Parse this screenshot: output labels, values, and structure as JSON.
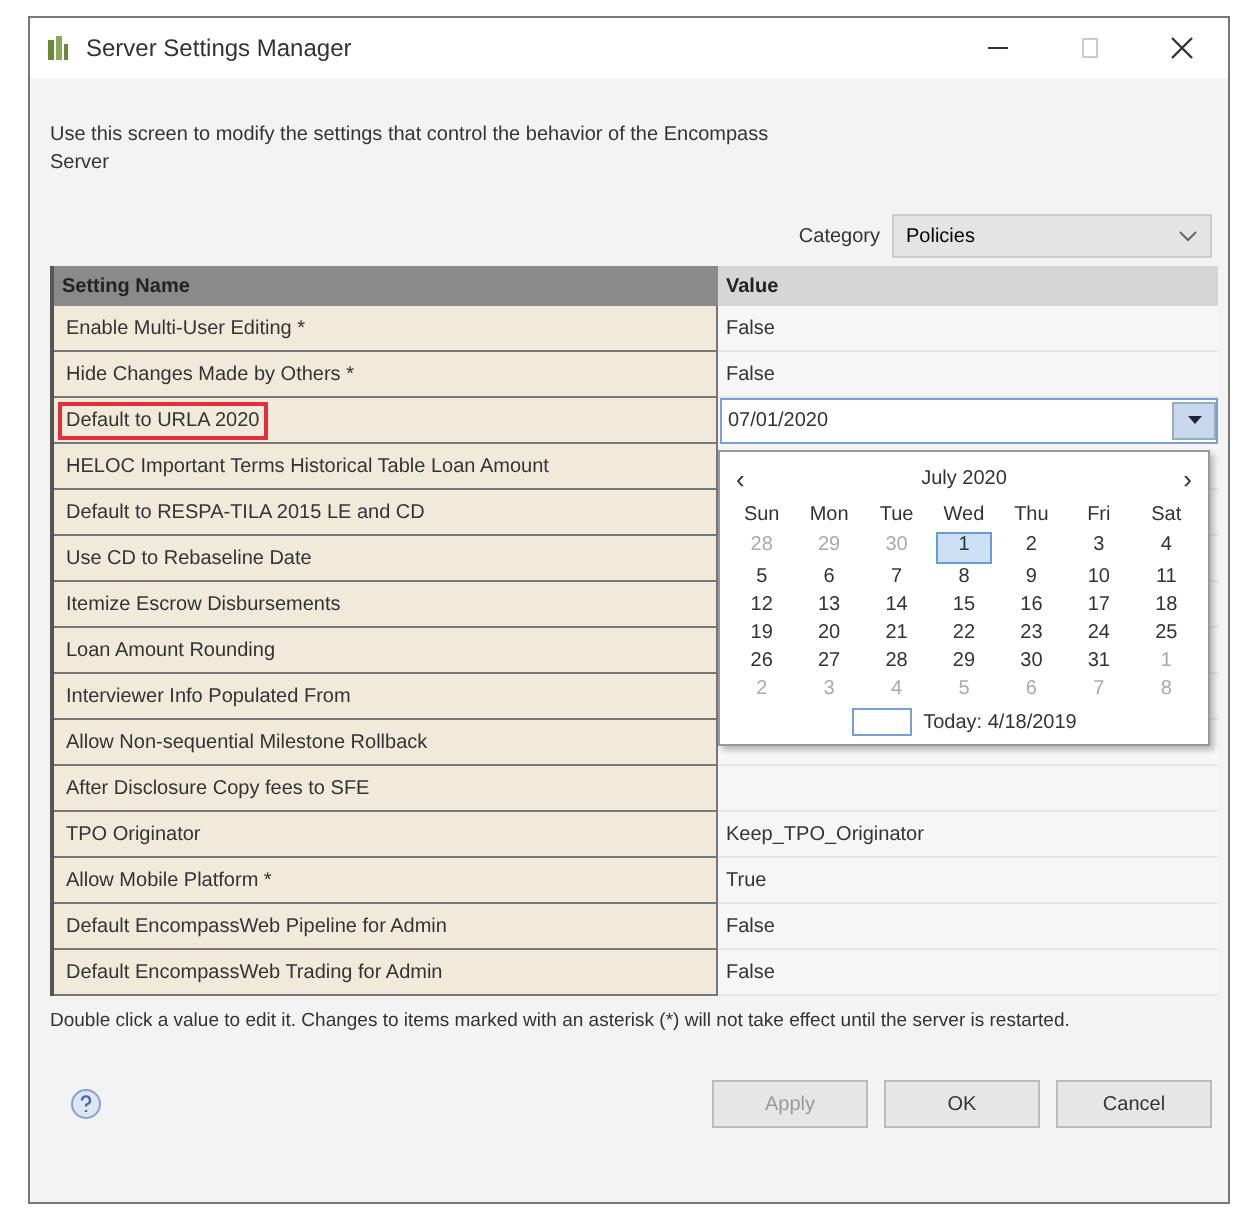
{
  "window": {
    "title": "Server Settings Manager"
  },
  "description": "Use this screen to modify the settings that control the behavior of the Encompass Server",
  "category": {
    "label": "Category",
    "value": "Policies"
  },
  "table": {
    "columns": [
      "Setting Name",
      "Value"
    ],
    "rows": [
      {
        "name": "Enable Multi-User Editing *",
        "value": "False",
        "kind": "text",
        "highlighted": false
      },
      {
        "name": "Hide Changes Made by Others *",
        "value": "False",
        "kind": "text",
        "highlighted": false
      },
      {
        "name": "Default to URLA 2020",
        "value": "07/01/2020",
        "kind": "date",
        "highlighted": true
      },
      {
        "name": "HELOC Important Terms Historical Table Loan Amount",
        "kind": "hidden",
        "highlighted": false
      },
      {
        "name": "Default to RESPA-TILA 2015 LE and CD",
        "kind": "hidden",
        "highlighted": false
      },
      {
        "name": "Use CD to Rebaseline Date",
        "kind": "hidden",
        "highlighted": false
      },
      {
        "name": "Itemize Escrow Disbursements",
        "kind": "hidden",
        "highlighted": false
      },
      {
        "name": "Loan Amount Rounding",
        "kind": "hidden",
        "highlighted": false
      },
      {
        "name": "Interviewer Info Populated From",
        "kind": "hidden",
        "highlighted": false
      },
      {
        "name": "Allow Non-sequential Milestone Rollback",
        "kind": "hidden",
        "highlighted": false
      },
      {
        "name": "After Disclosure Copy fees to SFE",
        "kind": "hidden",
        "highlighted": false
      },
      {
        "name": "TPO Originator",
        "value": "Keep_TPO_Originator",
        "kind": "text",
        "highlighted": false
      },
      {
        "name": "Allow Mobile Platform *",
        "value": "True",
        "kind": "text",
        "highlighted": false
      },
      {
        "name": "Default EncompassWeb Pipeline for Admin",
        "value": "False",
        "kind": "text",
        "highlighted": false
      },
      {
        "name": "Default EncompassWeb Trading for Admin",
        "value": "False",
        "kind": "text",
        "highlighted": false
      }
    ]
  },
  "calendar": {
    "prev": "‹",
    "next": "›",
    "month": "July 2020",
    "weekdays": [
      "Sun",
      "Mon",
      "Tue",
      "Wed",
      "Thu",
      "Fri",
      "Sat"
    ],
    "weeks": [
      [
        {
          "day": "28",
          "other": true,
          "selected": false
        },
        {
          "day": "29",
          "other": true,
          "selected": false
        },
        {
          "day": "30",
          "other": true,
          "selected": false
        },
        {
          "day": "1",
          "other": false,
          "selected": true
        },
        {
          "day": "2",
          "other": false,
          "selected": false
        },
        {
          "day": "3",
          "other": false,
          "selected": false
        },
        {
          "day": "4",
          "other": false,
          "selected": false
        }
      ],
      [
        {
          "day": "5",
          "other": false,
          "selected": false
        },
        {
          "day": "6",
          "other": false,
          "selected": false
        },
        {
          "day": "7",
          "other": false,
          "selected": false
        },
        {
          "day": "8",
          "other": false,
          "selected": false
        },
        {
          "day": "9",
          "other": false,
          "selected": false
        },
        {
          "day": "10",
          "other": false,
          "selected": false
        },
        {
          "day": "11",
          "other": false,
          "selected": false
        }
      ],
      [
        {
          "day": "12",
          "other": false,
          "selected": false
        },
        {
          "day": "13",
          "other": false,
          "selected": false
        },
        {
          "day": "14",
          "other": false,
          "selected": false
        },
        {
          "day": "15",
          "other": false,
          "selected": false
        },
        {
          "day": "16",
          "other": false,
          "selected": false
        },
        {
          "day": "17",
          "other": false,
          "selected": false
        },
        {
          "day": "18",
          "other": false,
          "selected": false
        }
      ],
      [
        {
          "day": "19",
          "other": false,
          "selected": false
        },
        {
          "day": "20",
          "other": false,
          "selected": false
        },
        {
          "day": "21",
          "other": false,
          "selected": false
        },
        {
          "day": "22",
          "other": false,
          "selected": false
        },
        {
          "day": "23",
          "other": false,
          "selected": false
        },
        {
          "day": "24",
          "other": false,
          "selected": false
        },
        {
          "day": "25",
          "other": false,
          "selected": false
        }
      ],
      [
        {
          "day": "26",
          "other": false,
          "selected": false
        },
        {
          "day": "27",
          "other": false,
          "selected": false
        },
        {
          "day": "28",
          "other": false,
          "selected": false
        },
        {
          "day": "29",
          "other": false,
          "selected": false
        },
        {
          "day": "30",
          "other": false,
          "selected": false
        },
        {
          "day": "31",
          "other": false,
          "selected": false
        },
        {
          "day": "1",
          "other": true,
          "selected": false
        }
      ],
      [
        {
          "day": "2",
          "other": true,
          "selected": false
        },
        {
          "day": "3",
          "other": true,
          "selected": false
        },
        {
          "day": "4",
          "other": true,
          "selected": false
        },
        {
          "day": "5",
          "other": true,
          "selected": false
        },
        {
          "day": "6",
          "other": true,
          "selected": false
        },
        {
          "day": "7",
          "other": true,
          "selected": false
        },
        {
          "day": "8",
          "other": true,
          "selected": false
        }
      ]
    ],
    "today": "Today: 4/18/2019"
  },
  "footer_note": "Double click a value to edit it. Changes to items marked with an asterisk (*) will not take effect until the server is restarted.",
  "buttons": [
    "Apply",
    "OK",
    "Cancel"
  ]
}
